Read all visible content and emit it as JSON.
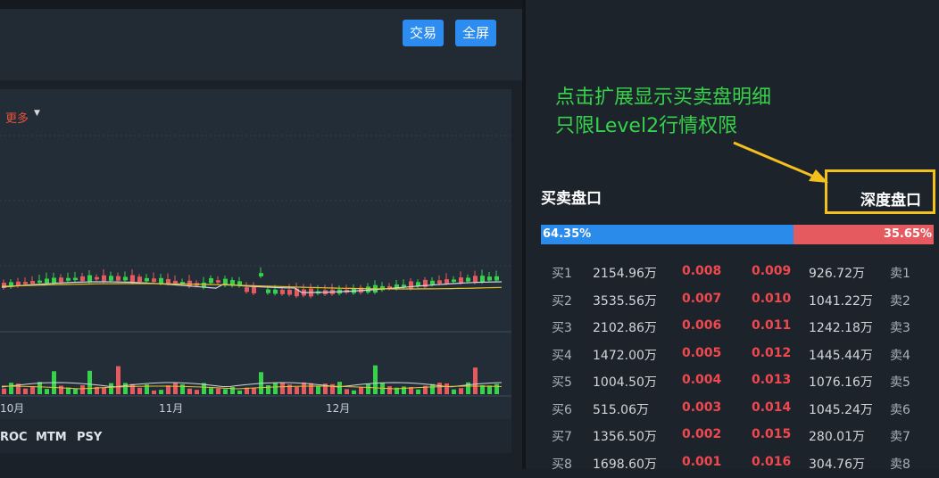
{
  "toolbar": {
    "trade_label": "交易",
    "fullscreen_label": "全屏"
  },
  "chart": {
    "more_label": "更多",
    "months": [
      "10月",
      "11月",
      "12月"
    ],
    "indicators": [
      "ROC",
      "MTM",
      "PSY"
    ]
  },
  "annotation": {
    "line1": "点击扩展显示买卖盘明细",
    "line2": "只限Level2行情权限"
  },
  "orderbook": {
    "title": "买卖盘口",
    "depth_label": "深度盘口",
    "buy_ratio": "64.35%",
    "sell_ratio": "35.65%",
    "buy_fraction": 0.6435,
    "rows": [
      {
        "buy_label": "买1",
        "buy_volume": "2154.96万",
        "buy_price": "0.008",
        "sell_price": "0.009",
        "sell_volume": "926.72万",
        "sell_label": "卖1"
      },
      {
        "buy_label": "买2",
        "buy_volume": "3535.56万",
        "buy_price": "0.007",
        "sell_price": "0.010",
        "sell_volume": "1041.22万",
        "sell_label": "卖2"
      },
      {
        "buy_label": "买3",
        "buy_volume": "2102.86万",
        "buy_price": "0.006",
        "sell_price": "0.011",
        "sell_volume": "1242.18万",
        "sell_label": "卖3"
      },
      {
        "buy_label": "买4",
        "buy_volume": "1472.00万",
        "buy_price": "0.005",
        "sell_price": "0.012",
        "sell_volume": "1445.44万",
        "sell_label": "卖4"
      },
      {
        "buy_label": "买5",
        "buy_volume": "1004.50万",
        "buy_price": "0.004",
        "sell_price": "0.013",
        "sell_volume": "1076.16万",
        "sell_label": "卖5"
      },
      {
        "buy_label": "买6",
        "buy_volume": "515.06万",
        "buy_price": "0.003",
        "sell_price": "0.014",
        "sell_volume": "1045.24万",
        "sell_label": "卖6"
      },
      {
        "buy_label": "买7",
        "buy_volume": "1356.50万",
        "buy_price": "0.002",
        "sell_price": "0.015",
        "sell_volume": "280.01万",
        "sell_label": "卖7"
      },
      {
        "buy_label": "买8",
        "buy_volume": "1698.60万",
        "buy_price": "0.001",
        "sell_price": "0.016",
        "sell_volume": "304.76万",
        "sell_label": "卖8"
      }
    ]
  },
  "colors": {
    "accent": "#2d8cf0",
    "up": "#e45a5f",
    "down": "#35d24a",
    "annotation": "#35d24a",
    "highlight": "#f4c01e"
  }
}
